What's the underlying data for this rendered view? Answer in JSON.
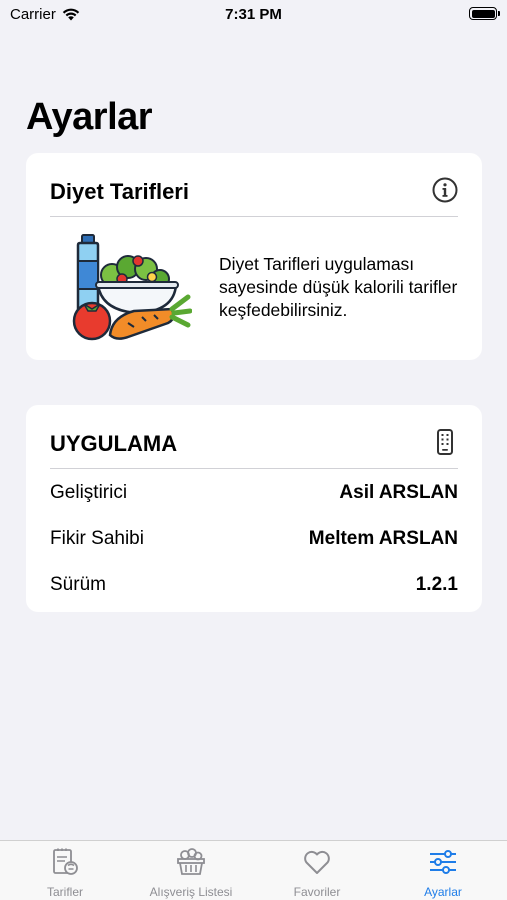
{
  "status_bar": {
    "carrier": "Carrier",
    "time": "7:31 PM"
  },
  "page": {
    "title": "Ayarlar"
  },
  "diet_card": {
    "title": "Diyet Tarifleri",
    "icon": "info-icon",
    "description": "Diyet Tarifleri uygulaması sayesinde düşük kalorili tarifler keşfedebilirsiniz."
  },
  "app_card": {
    "title": "UYGULAMA",
    "icon": "phone-icon",
    "rows": [
      {
        "label": "Geliştirici",
        "value": "Asil ARSLAN"
      },
      {
        "label": "Fikir Sahibi",
        "value": "Meltem ARSLAN"
      },
      {
        "label": "Sürüm",
        "value": "1.2.1"
      }
    ]
  },
  "tab_bar": {
    "active_color": "#1f7de8",
    "tabs": [
      {
        "label": "Tarifler",
        "icon": "recipe-icon"
      },
      {
        "label": "Alışveriş Listesi",
        "icon": "basket-icon"
      },
      {
        "label": "Favoriler",
        "icon": "heart-icon"
      },
      {
        "label": "Ayarlar",
        "icon": "sliders-icon",
        "active": true
      }
    ]
  }
}
